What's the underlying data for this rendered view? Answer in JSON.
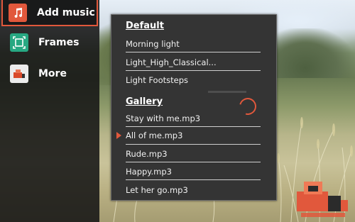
{
  "sidebar": {
    "items": [
      {
        "label": "Add music",
        "icon": "music-note-icon"
      },
      {
        "label": "Frames",
        "icon": "frames-icon"
      },
      {
        "label": "More",
        "icon": "more-apps-icon"
      }
    ]
  },
  "dropdown": {
    "default_title": "Default",
    "default_items": [
      "Morning light",
      "Light_High_Classical...",
      "Light Footsteps"
    ],
    "gallery_title": "Gallery",
    "gallery_items": [
      "Stay with me.mp3",
      "All of me.mp3",
      "Rude.mp3",
      "Happy.mp3",
      "Let her go.mp3"
    ],
    "selected": "All of me.mp3"
  },
  "colors": {
    "accent": "#e1583c",
    "panel_bg": "#343434",
    "sidebar_bg": "#161616"
  }
}
